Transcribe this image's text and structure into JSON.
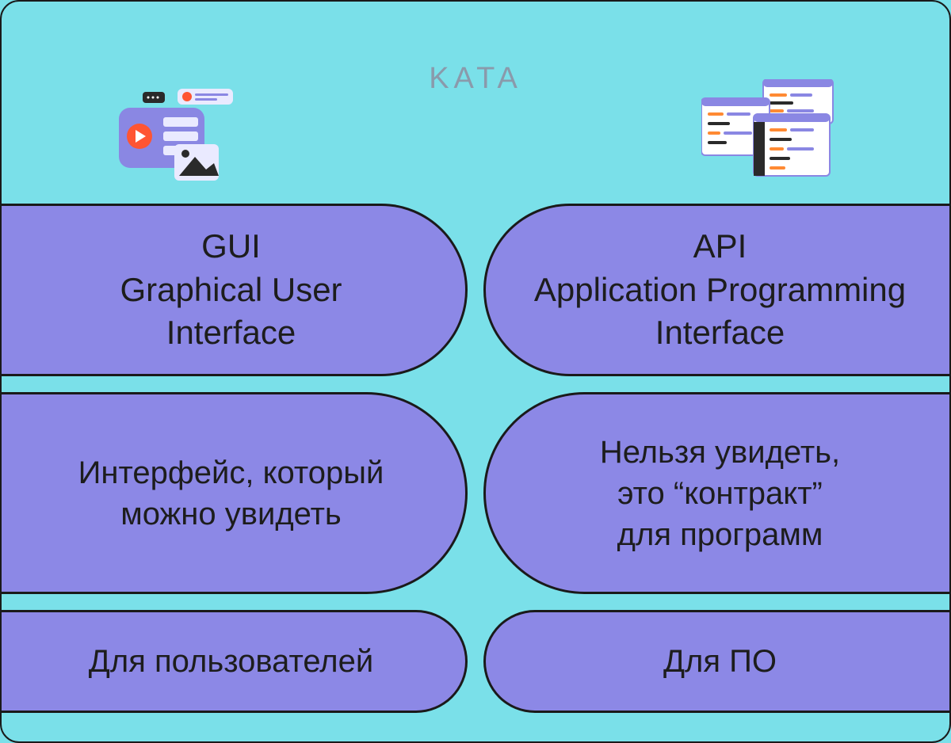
{
  "logo": "KATA",
  "columns": {
    "left": {
      "title_line1": "GUI",
      "title_line2": "Graphical User",
      "title_line3": "Interface",
      "desc_line1": "Интерфейс, который",
      "desc_line2": "можно увидеть",
      "audience": "Для пользователей"
    },
    "right": {
      "title_line1": "API",
      "title_line2": "Application Programming",
      "title_line3": "Interface",
      "desc_line1": "Нельзя увидеть,",
      "desc_line2": "это “контракт”",
      "desc_line3": "для программ",
      "audience": "Для ПО"
    }
  }
}
